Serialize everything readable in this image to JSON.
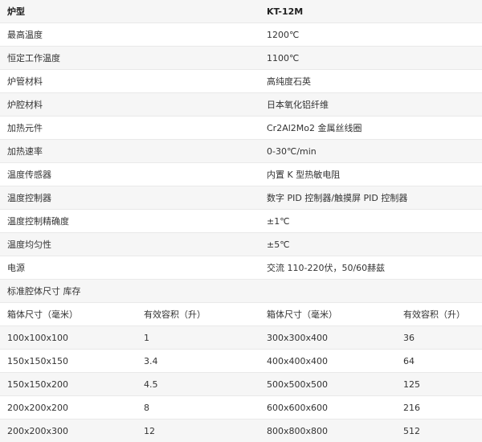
{
  "spec_table": {
    "header": {
      "label": "炉型",
      "value": "KT-12M"
    },
    "rows": [
      {
        "label": "最高温度",
        "value": "1200℃"
      },
      {
        "label": "恒定工作温度",
        "value": "1100℃"
      },
      {
        "label": "炉管材料",
        "value": "高纯度石英"
      },
      {
        "label": "炉腔材料",
        "value": "日本氧化铝纤维"
      },
      {
        "label": "加热元件",
        "value": "Cr2Al2Mo2 金属丝线圈"
      },
      {
        "label": "加热速率",
        "value": "0-30℃/min"
      },
      {
        "label": "温度传感器",
        "value": "内置 K 型热敏电阻"
      },
      {
        "label": "温度控制器",
        "value": "数字 PID 控制器/触摸屏 PID 控制器"
      },
      {
        "label": "温度控制精确度",
        "value": "±1℃"
      },
      {
        "label": "温度均匀性",
        "value": "±5℃"
      },
      {
        "label": "电源",
        "value": "交流 110-220伏，50/60赫兹"
      }
    ],
    "section_title": "标准腔体尺寸 库存",
    "size_header": [
      "箱体尺寸（毫米）",
      "有效容积（升）",
      "箱体尺寸（毫米）",
      "有效容积（升）"
    ],
    "size_rows": [
      [
        "100x100x100",
        "1",
        "300x300x400",
        "36"
      ],
      [
        "150x150x150",
        "3.4",
        "400x400x400",
        "64"
      ],
      [
        "150x150x200",
        "4.5",
        "500x500x500",
        "125"
      ],
      [
        "200x200x200",
        "8",
        "600x600x600",
        "216"
      ],
      [
        "200x200x300",
        "12",
        "800x800x800",
        "512"
      ]
    ]
  }
}
